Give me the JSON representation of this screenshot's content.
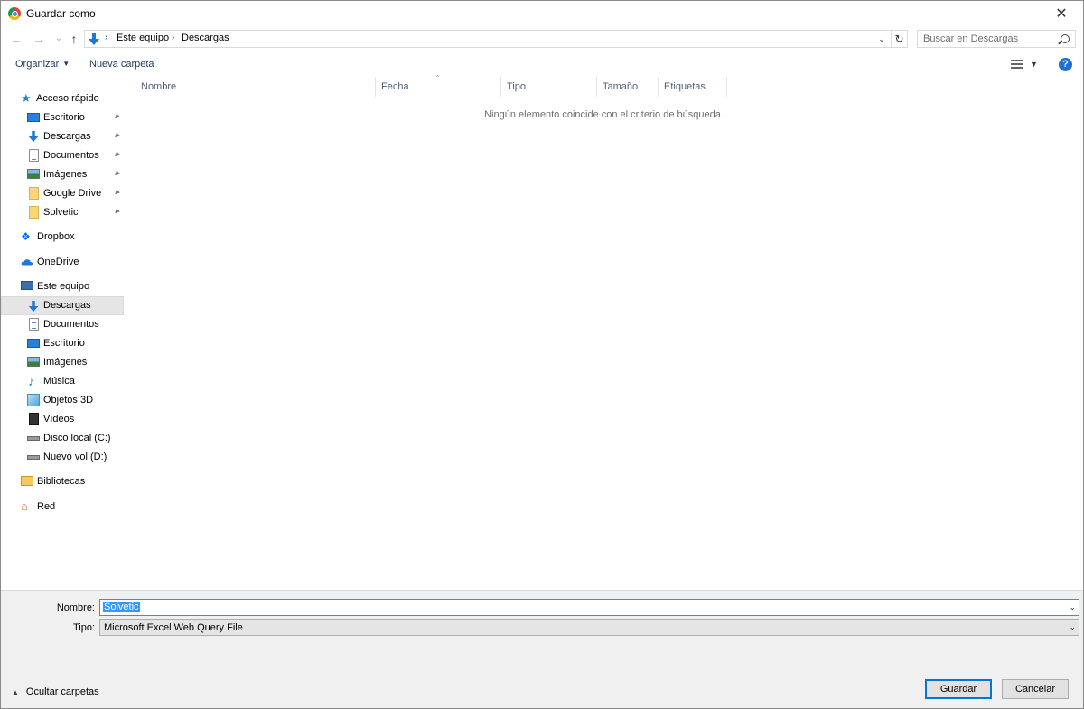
{
  "window": {
    "title": "Guardar como",
    "close": "✕"
  },
  "nav": {
    "back": "←",
    "forward": "→",
    "recent": "⌄",
    "up": "↑"
  },
  "address": {
    "crumbs": [
      "Este equipo",
      "Descargas"
    ],
    "sep": "›",
    "dropdown": "⌄",
    "refresh": "↻"
  },
  "search": {
    "placeholder": "Buscar en Descargas"
  },
  "toolbar": {
    "organize": "Organizar",
    "organize_caret": "▼",
    "new_folder": "Nueva carpeta",
    "view_caret": "▼",
    "help": "?"
  },
  "sidebar": {
    "quick_access": "Acceso rápido",
    "quick_items": [
      "Escritorio",
      "Descargas",
      "Documentos",
      "Imágenes",
      "Google Drive",
      "Solvetic"
    ],
    "pin": "📌",
    "dropbox": "Dropbox",
    "onedrive": "OneDrive",
    "this_pc": "Este equipo",
    "pc_items": [
      "Descargas",
      "Documentos",
      "Escritorio",
      "Imágenes",
      "Música",
      "Objetos 3D",
      "Vídeos",
      "Disco local (C:)",
      "Nuevo vol (D:)"
    ],
    "libraries": "Bibliotecas",
    "network": "Red"
  },
  "columns": [
    "Nombre",
    "Fecha",
    "Tipo",
    "Tamaño",
    "Etiquetas"
  ],
  "sort_caret": "⌃",
  "empty_message": "Ningún elemento coincide con el criterio de búsqueda.",
  "form": {
    "name_label": "Nombre:",
    "name_value": "Solvetic",
    "type_label": "Tipo:",
    "type_value": "Microsoft Excel Web Query File",
    "arrow": "⌄"
  },
  "footer": {
    "toggle_caret": "▲",
    "toggle_label": "Ocultar carpetas",
    "save": "Guardar",
    "cancel": "Cancelar"
  },
  "colors": {
    "accent": "#0078d7",
    "selection": "#3399ff",
    "panel": "#f0f0f0"
  }
}
